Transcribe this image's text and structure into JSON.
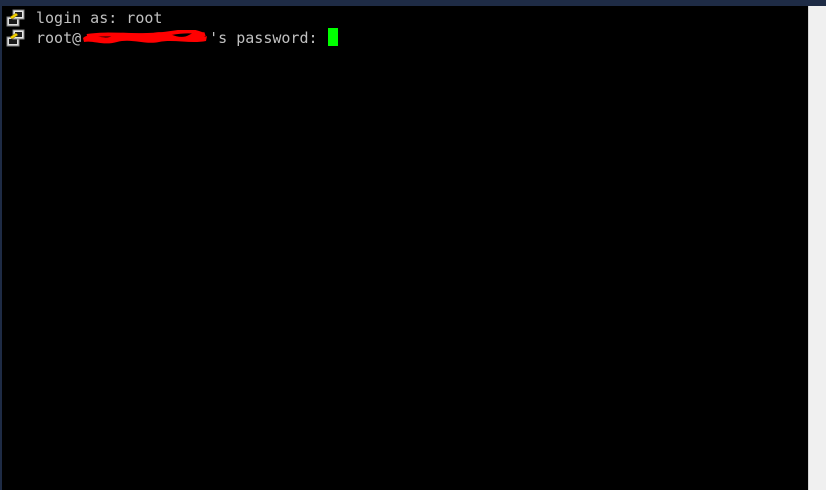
{
  "terminal": {
    "lines": [
      {
        "text": "login as: root",
        "icon": "putty-icon"
      },
      {
        "prefix": "root@",
        "suffix": "'s password: ",
        "icon": "putty-icon",
        "redacted": true
      }
    ],
    "cursor_color": "#00ff00",
    "text_color": "#c0c0c0",
    "background_color": "#000000"
  },
  "colors": {
    "redaction": "#ff0000",
    "scrollbar": "#f0f0f0",
    "frame": "#1e2b45"
  }
}
